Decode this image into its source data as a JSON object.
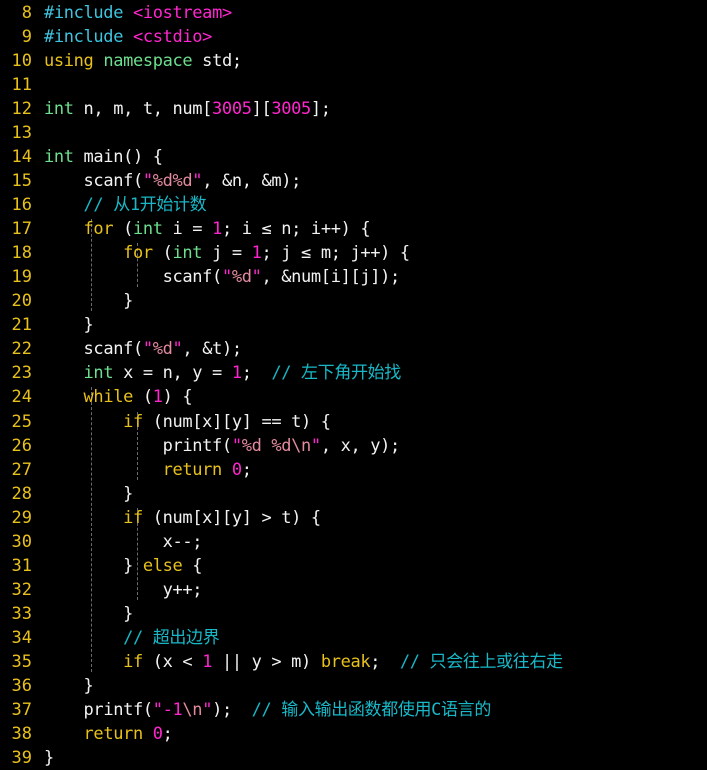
{
  "editor": {
    "background": "#000000",
    "gutter_color": "#e8c11c",
    "default_text_color": "#f2f2f2",
    "first_line_number": 8,
    "last_line_number": 39,
    "language": "cpp",
    "colors": {
      "preprocessor": "#3fc4e0",
      "header_name": "#ff26d0",
      "keyword": "#e8c11c",
      "type": "#6ddf8e",
      "number": "#ff26d0",
      "string": "#e38a9e",
      "quote": "#ff26d0",
      "comment": "#18b8c8",
      "plain": "#f2f2f2",
      "indent_guide": "#6b6b6b"
    }
  },
  "lines": [
    {
      "num": "8",
      "indent": 0,
      "tokens": [
        {
          "t": "#include",
          "c": "preproc"
        },
        {
          "t": " ",
          "c": "plain"
        },
        {
          "t": "<iostream>",
          "c": "header"
        }
      ]
    },
    {
      "num": "9",
      "indent": 0,
      "tokens": [
        {
          "t": "#include",
          "c": "preproc"
        },
        {
          "t": " ",
          "c": "plain"
        },
        {
          "t": "<cstdio>",
          "c": "header"
        }
      ]
    },
    {
      "num": "10",
      "indent": 0,
      "tokens": [
        {
          "t": "using",
          "c": "keyword"
        },
        {
          "t": " ",
          "c": "plain"
        },
        {
          "t": "namespace",
          "c": "ns"
        },
        {
          "t": " std;",
          "c": "plain"
        }
      ]
    },
    {
      "num": "11",
      "indent": 0,
      "tokens": []
    },
    {
      "num": "12",
      "indent": 0,
      "tokens": [
        {
          "t": "int",
          "c": "type"
        },
        {
          "t": " n, m, t, num[",
          "c": "plain"
        },
        {
          "t": "3005",
          "c": "number"
        },
        {
          "t": "][",
          "c": "plain"
        },
        {
          "t": "3005",
          "c": "number"
        },
        {
          "t": "];",
          "c": "plain"
        }
      ]
    },
    {
      "num": "13",
      "indent": 0,
      "tokens": []
    },
    {
      "num": "14",
      "indent": 0,
      "tokens": [
        {
          "t": "int",
          "c": "type"
        },
        {
          "t": " main() {",
          "c": "plain"
        }
      ]
    },
    {
      "num": "15",
      "indent": 1,
      "tokens": [
        {
          "t": "scanf(",
          "c": "plain"
        },
        {
          "t": "\"",
          "c": "quote"
        },
        {
          "t": "%d%d",
          "c": "string"
        },
        {
          "t": "\"",
          "c": "quote"
        },
        {
          "t": ", &n, &m);",
          "c": "plain"
        }
      ]
    },
    {
      "num": "16",
      "indent": 1,
      "tokens": [
        {
          "t": "// 从1开始计数",
          "c": "comment"
        }
      ]
    },
    {
      "num": "17",
      "indent": 1,
      "tokens": [
        {
          "t": "for",
          "c": "keyword"
        },
        {
          "t": " (",
          "c": "plain"
        },
        {
          "t": "int",
          "c": "type"
        },
        {
          "t": " i = ",
          "c": "plain"
        },
        {
          "t": "1",
          "c": "number"
        },
        {
          "t": "; i ≤ n; i++) {",
          "c": "plain"
        }
      ]
    },
    {
      "num": "18",
      "indent": 2,
      "tokens": [
        {
          "t": "for",
          "c": "keyword"
        },
        {
          "t": " (",
          "c": "plain"
        },
        {
          "t": "int",
          "c": "type"
        },
        {
          "t": " j = ",
          "c": "plain"
        },
        {
          "t": "1",
          "c": "number"
        },
        {
          "t": "; j ≤ m; j++) {",
          "c": "plain"
        }
      ]
    },
    {
      "num": "19",
      "indent": 3,
      "tokens": [
        {
          "t": "scanf(",
          "c": "plain"
        },
        {
          "t": "\"",
          "c": "quote"
        },
        {
          "t": "%d",
          "c": "string"
        },
        {
          "t": "\"",
          "c": "quote"
        },
        {
          "t": ", &num[i][j]);",
          "c": "plain"
        }
      ]
    },
    {
      "num": "20",
      "indent": 2,
      "tokens": [
        {
          "t": "}",
          "c": "plain"
        }
      ]
    },
    {
      "num": "21",
      "indent": 1,
      "tokens": [
        {
          "t": "}",
          "c": "plain"
        }
      ]
    },
    {
      "num": "22",
      "indent": 1,
      "tokens": [
        {
          "t": "scanf(",
          "c": "plain"
        },
        {
          "t": "\"",
          "c": "quote"
        },
        {
          "t": "%d",
          "c": "string"
        },
        {
          "t": "\"",
          "c": "quote"
        },
        {
          "t": ", &t);",
          "c": "plain"
        }
      ]
    },
    {
      "num": "23",
      "indent": 1,
      "tokens": [
        {
          "t": "int",
          "c": "type"
        },
        {
          "t": " x = n, y = ",
          "c": "plain"
        },
        {
          "t": "1",
          "c": "number"
        },
        {
          "t": ";  ",
          "c": "plain"
        },
        {
          "t": "// 左下角开始找",
          "c": "comment"
        }
      ]
    },
    {
      "num": "24",
      "indent": 1,
      "tokens": [
        {
          "t": "while",
          "c": "keyword"
        },
        {
          "t": " (",
          "c": "plain"
        },
        {
          "t": "1",
          "c": "number"
        },
        {
          "t": ") {",
          "c": "plain"
        }
      ]
    },
    {
      "num": "25",
      "indent": 2,
      "tokens": [
        {
          "t": "if",
          "c": "keyword"
        },
        {
          "t": " (num[x][y] == t) {",
          "c": "plain"
        }
      ]
    },
    {
      "num": "26",
      "indent": 3,
      "tokens": [
        {
          "t": "printf(",
          "c": "plain"
        },
        {
          "t": "\"",
          "c": "quote"
        },
        {
          "t": "%d %d\\n",
          "c": "string"
        },
        {
          "t": "\"",
          "c": "quote"
        },
        {
          "t": ", x, y);",
          "c": "plain"
        }
      ]
    },
    {
      "num": "27",
      "indent": 3,
      "tokens": [
        {
          "t": "return",
          "c": "keyword"
        },
        {
          "t": " ",
          "c": "plain"
        },
        {
          "t": "0",
          "c": "number"
        },
        {
          "t": ";",
          "c": "plain"
        }
      ]
    },
    {
      "num": "28",
      "indent": 2,
      "tokens": [
        {
          "t": "}",
          "c": "plain"
        }
      ]
    },
    {
      "num": "29",
      "indent": 2,
      "tokens": [
        {
          "t": "if",
          "c": "keyword"
        },
        {
          "t": " (num[x][y] > t) {",
          "c": "plain"
        }
      ]
    },
    {
      "num": "30",
      "indent": 3,
      "tokens": [
        {
          "t": "x--;",
          "c": "plain"
        }
      ]
    },
    {
      "num": "31",
      "indent": 2,
      "tokens": [
        {
          "t": "} ",
          "c": "plain"
        },
        {
          "t": "else",
          "c": "keyword"
        },
        {
          "t": " {",
          "c": "plain"
        }
      ]
    },
    {
      "num": "32",
      "indent": 3,
      "tokens": [
        {
          "t": "y++;",
          "c": "plain"
        }
      ]
    },
    {
      "num": "33",
      "indent": 2,
      "tokens": [
        {
          "t": "}",
          "c": "plain"
        }
      ]
    },
    {
      "num": "34",
      "indent": 2,
      "tokens": [
        {
          "t": "// 超出边界",
          "c": "comment"
        }
      ]
    },
    {
      "num": "35",
      "indent": 2,
      "tokens": [
        {
          "t": "if",
          "c": "keyword"
        },
        {
          "t": " (x < ",
          "c": "plain"
        },
        {
          "t": "1",
          "c": "number"
        },
        {
          "t": " || y > m) ",
          "c": "plain"
        },
        {
          "t": "break",
          "c": "keyword"
        },
        {
          "t": ";  ",
          "c": "plain"
        },
        {
          "t": "// 只会往上或往右走",
          "c": "comment"
        }
      ]
    },
    {
      "num": "36",
      "indent": 1,
      "tokens": [
        {
          "t": "}",
          "c": "plain"
        }
      ]
    },
    {
      "num": "37",
      "indent": 1,
      "tokens": [
        {
          "t": "printf(",
          "c": "plain"
        },
        {
          "t": "\"",
          "c": "quote"
        },
        {
          "t": "-1",
          "c": "number"
        },
        {
          "t": "\\n",
          "c": "string"
        },
        {
          "t": "\"",
          "c": "quote"
        },
        {
          "t": ");  ",
          "c": "plain"
        },
        {
          "t": "// 输入输出函数都使用C语言的",
          "c": "comment"
        }
      ]
    },
    {
      "num": "38",
      "indent": 1,
      "tokens": [
        {
          "t": "return",
          "c": "keyword"
        },
        {
          "t": " ",
          "c": "plain"
        },
        {
          "t": "0",
          "c": "number"
        },
        {
          "t": ";",
          "c": "plain"
        }
      ]
    },
    {
      "num": "39",
      "indent": 0,
      "tokens": [
        {
          "t": "}",
          "c": "plain"
        }
      ]
    }
  ],
  "indent_guides": [
    {
      "col": 1,
      "top_line": 17,
      "bottom_line": 21
    },
    {
      "col": 2,
      "top_line": 18,
      "bottom_line": 20
    },
    {
      "col": 1,
      "top_line": 24,
      "bottom_line": 36
    },
    {
      "col": 2,
      "top_line": 25,
      "bottom_line": 28
    },
    {
      "col": 2,
      "top_line": 29,
      "bottom_line": 33
    }
  ]
}
